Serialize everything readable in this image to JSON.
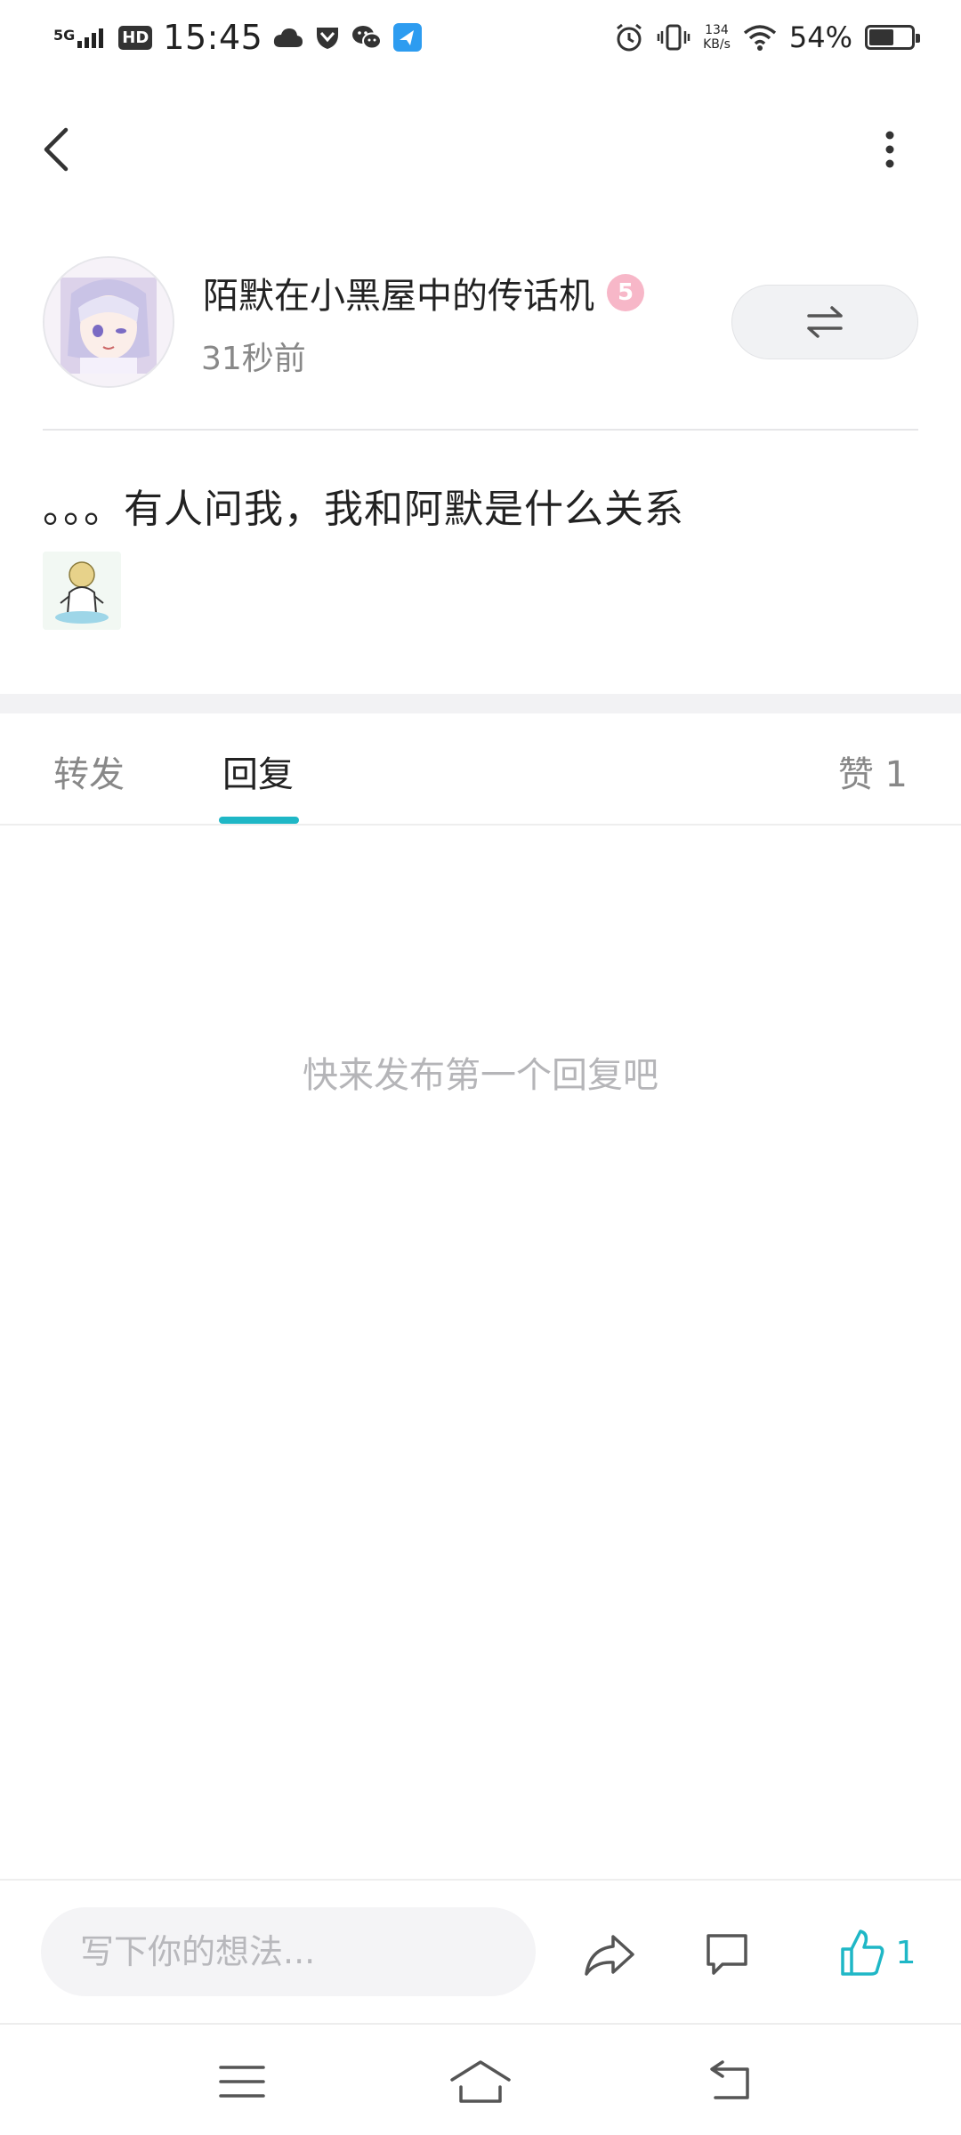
{
  "status_bar": {
    "signal": "5G",
    "hd": "HD",
    "time": "15:45",
    "speed_value": "134",
    "speed_unit": "KB/s",
    "battery_percent": "54%",
    "battery_level": 0.54
  },
  "post": {
    "author": "陌默在小黑屋中的传话机",
    "level_badge": "5",
    "time_ago": "31秒前",
    "text": "。。。有人问我，我和阿默是什么关系"
  },
  "tabs": {
    "forward": "转发",
    "reply": "回复",
    "like": "赞 1"
  },
  "empty_hint": "快来发布第一个回复吧",
  "comment_bar": {
    "placeholder": "写下你的想法...",
    "like_count": "1"
  },
  "colors": {
    "accent": "#1fb7c6",
    "text": "#222222",
    "muted": "#888888"
  }
}
